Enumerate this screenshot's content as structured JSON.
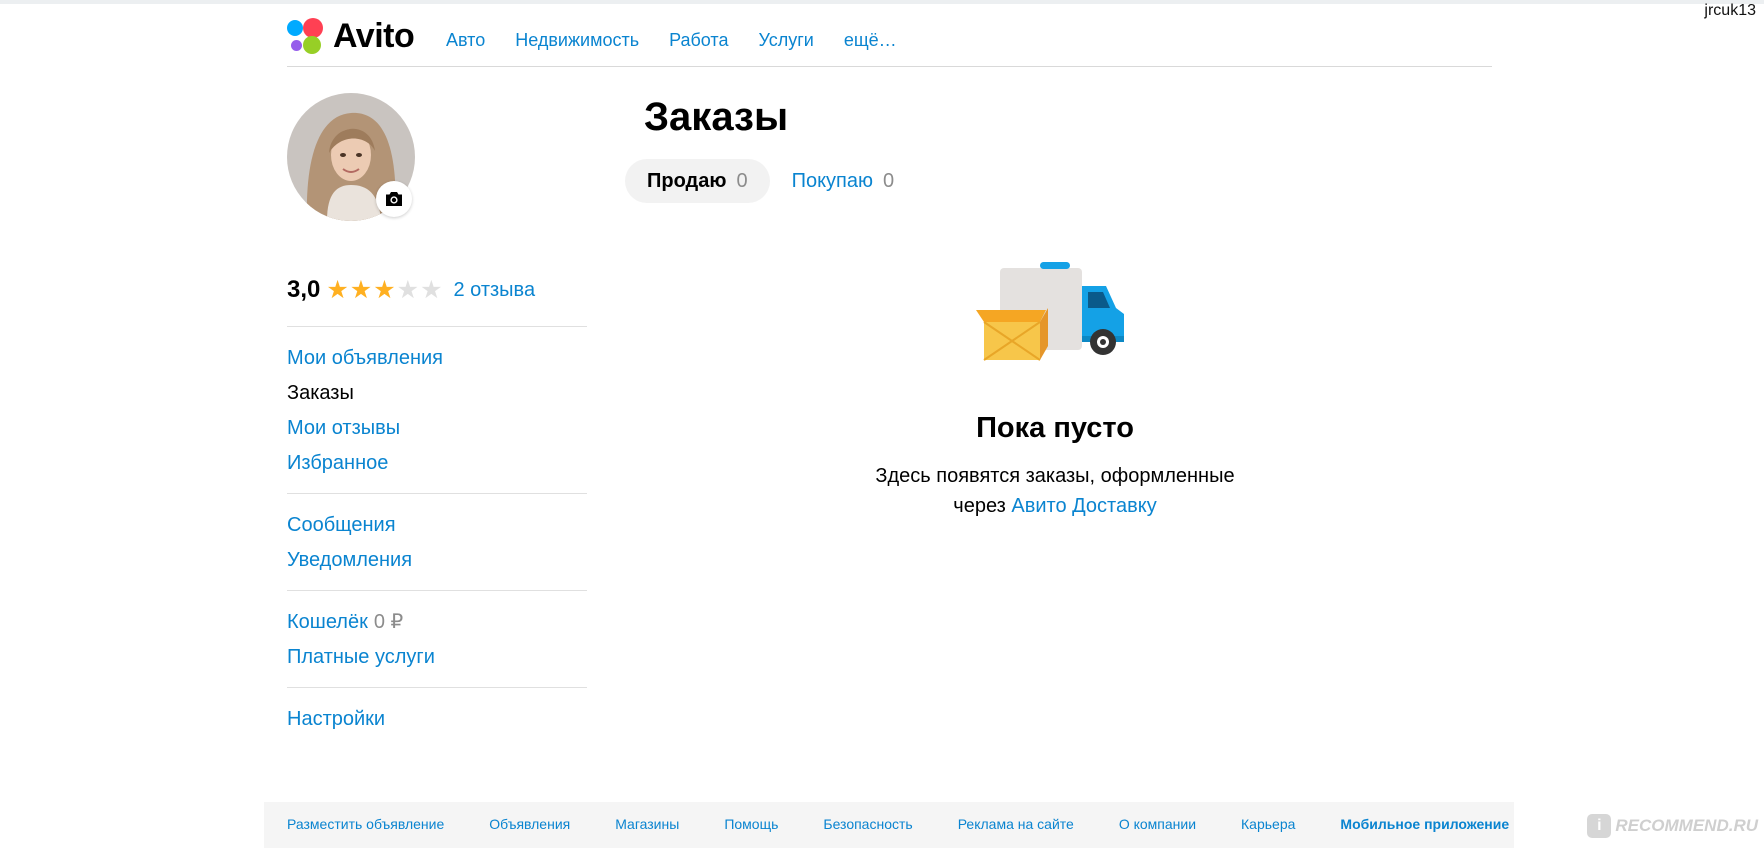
{
  "watermark_user": "jrcuk13",
  "logo": {
    "text": "Avito"
  },
  "nav": [
    "Авто",
    "Недвижимость",
    "Работа",
    "Услуги",
    "ещё…"
  ],
  "profile": {
    "rating": "3,0",
    "stars_filled": 3,
    "stars_total": 5,
    "reviews_link": "2 отзыва"
  },
  "sidebar": {
    "group1": [
      "Мои объявления",
      "Заказы",
      "Мои отзывы",
      "Избранное"
    ],
    "group2": [
      "Сообщения",
      "Уведомления"
    ],
    "wallet_label": "Кошелёк",
    "wallet_amount": "0 ₽",
    "paid_services": "Платные услуги",
    "settings": "Настройки"
  },
  "main": {
    "title": "Заказы",
    "tabs": [
      {
        "label": "Продаю",
        "count": "0"
      },
      {
        "label": "Покупаю",
        "count": "0"
      }
    ],
    "empty_title": "Пока пусто",
    "empty_line1": "Здесь появятся заказы, оформленные",
    "empty_line2_prefix": "через",
    "empty_link": "Авито Доставку"
  },
  "footer": {
    "links": [
      "Разместить объявление",
      "Объявления",
      "Магазины",
      "Помощь",
      "Безопасность",
      "Реклама на сайте",
      "О компании",
      "Карьера"
    ],
    "app_link": "Мобильное приложение"
  },
  "recommend_watermark": "RECOMMEND.RU",
  "colors": {
    "link": "#0a84d0",
    "star_filled": "#ffb021",
    "star_empty": "#e0e0e0",
    "logo_blue": "#00aaff",
    "logo_red": "#ff4053",
    "logo_purple": "#965eeb",
    "logo_green": "#97cf26"
  }
}
